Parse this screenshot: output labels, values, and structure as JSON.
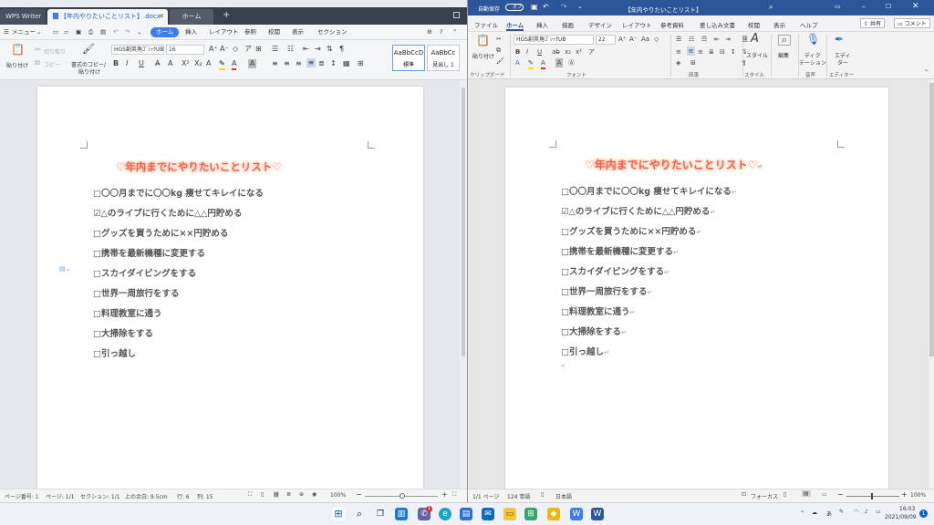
{
  "wps": {
    "tabs": {
      "app": "WPS Writer",
      "doc": "【年内やりたいことリスト】.docx",
      "home": "ホーム",
      "add": "+"
    },
    "menubar": {
      "menu": "メニュー",
      "items": [
        "ホーム",
        "挿入",
        "レイアウト",
        "参照",
        "校閲",
        "表示",
        "セクション"
      ]
    },
    "ribbon": {
      "paste": "貼り付け",
      "cut": "切り取り",
      "copy": "コピー",
      "format_painter_line1": "書式のコピー/",
      "format_painter_line2": "貼り付け",
      "font_name": "HGS創英角ｺﾞｼｯｸUB",
      "font_size": "16",
      "style1_preview": "AaBbCcD",
      "style1_label": "標準",
      "style2_preview": "AaBbCc",
      "style2_label": "見出し 1"
    },
    "status": {
      "page_no": "ページ番号: 1",
      "page": "ページ: 1/1",
      "section": "セクション: 1/1",
      "margin": "上の余白: 9.5cm",
      "row": "行: 6",
      "col": "列: 15",
      "zoom": "100%"
    }
  },
  "document": {
    "title": "♡年内までにやりたいことリスト♡",
    "items": [
      "□〇〇月までに〇〇kg 痩せてキレイになる",
      "☑△のライブに行くために△△円貯める",
      "□グッズを買うために××円貯める",
      "□携帯を最新機種に変更する",
      "□スカイダイビングをする",
      "□世界一周旅行をする",
      "□料理教室に通う",
      "□大掃除をする",
      "□引っ越し"
    ],
    "para_mark": "↵"
  },
  "word": {
    "title_bar": {
      "autosave_label": "自動保存",
      "autosave_state": "オフ",
      "doc_title": "【年内やりたいことリスト】"
    },
    "menu": [
      "ファイル",
      "ホーム",
      "挿入",
      "描画",
      "デザイン",
      "レイアウト",
      "参考資料",
      "差し込み文書",
      "校閲",
      "表示",
      "ヘルプ"
    ],
    "share": "共有",
    "comment": "コメント",
    "ribbon": {
      "paste": "貼り付け",
      "font_name": "HGS創英角ｺﾞｼｯｸUB",
      "font_size": "22",
      "styles": "スタイル",
      "edit": "編集",
      "dictate_line1": "ディク",
      "dictate_line2": "テーション",
      "editor_line1": "エディ",
      "editor_line2": "ター",
      "groups": [
        "クリップボード",
        "フォント",
        "段落",
        "スタイル",
        "音声",
        "エディター"
      ]
    },
    "status": {
      "page": "1/1 ページ",
      "words": "124 単語",
      "lang": "日本語",
      "focus": "フォーカス",
      "zoom": "100%"
    }
  },
  "taskbar": {
    "time": "16:03",
    "date": "2021/09/09",
    "ime": "あ",
    "notification_count": "1",
    "chat_badge": "1"
  },
  "colors": {
    "word_blue": "#2b579a",
    "wps_accent": "#3c7cf0",
    "title_red": "#ff5a5a"
  }
}
